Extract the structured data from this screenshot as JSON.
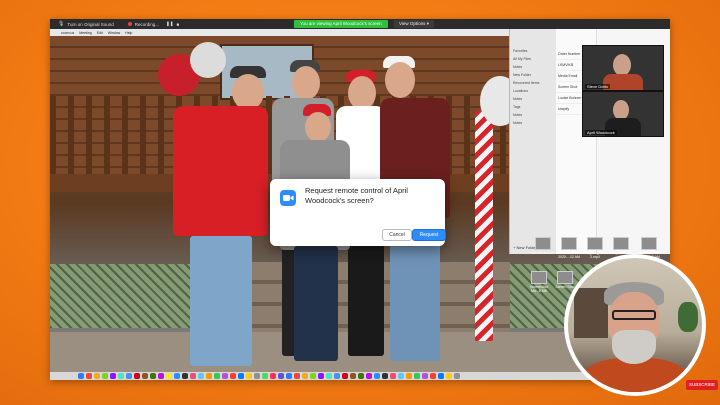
{
  "share_bar": {
    "original_sound": "Turn on Original Sound",
    "recording": "Recording...",
    "viewing_banner": "You are viewing April Woodcock's screen",
    "view_options": "View Options"
  },
  "mac_menu": [
    "zoom.us",
    "Meeting",
    "Edit",
    "Window",
    "Help"
  ],
  "finder": {
    "sidebar": [
      "Favorites",
      "All My Files",
      "Notes",
      "New Folder",
      "Recovered Items",
      "Locations",
      "Notes",
      "Tags",
      "Notes",
      "Notes"
    ],
    "column": [
      "Order Number",
      "LKMVIKB",
      "Media Email",
      "Screen Shot",
      "Louise Bohnen",
      "shopify"
    ],
    "new_folder": "New Folder"
  },
  "video_tiles": [
    {
      "name": "Steve Dotto"
    },
    {
      "name": "April Woodcock"
    }
  ],
  "desktop_icons": [
    {
      "label": "Second Screen"
    },
    {
      "label": "Screen Shot 2020-...12 AM"
    },
    {
      "label": "USA_041_DEL... 2.mp4"
    },
    {
      "label": "IMG_2113_M..."
    },
    {
      "label": "Screen Shot 2020-...12 AM"
    },
    {
      "label": "Screenshot Ma...8 MB"
    },
    {
      "label": "Screen Shot"
    }
  ],
  "dialog": {
    "message": "Request remote control of April Woodcock's screen?",
    "cancel": "Cancel",
    "request": "Request"
  },
  "dock_colors": [
    "#3478f6",
    "#e5483d",
    "#f5a623",
    "#7ed321",
    "#9013fe",
    "#50e3c2",
    "#4a90e2",
    "#d0021b",
    "#8b572a",
    "#417505",
    "#bd10e0",
    "#f8e71c",
    "#2d8cff",
    "#333333",
    "#e94e77",
    "#5ac8fa",
    "#ff9500",
    "#34c759",
    "#af52de",
    "#ff3b30",
    "#007aff",
    "#ffcc00",
    "#8e8e93",
    "#4cd964",
    "#ff2d55",
    "#5856d6",
    "#3478f6",
    "#e5483d",
    "#f5a623",
    "#7ed321",
    "#9013fe",
    "#50e3c2",
    "#4a90e2",
    "#d0021b",
    "#8b572a",
    "#417505",
    "#bd10e0",
    "#2d8cff",
    "#333333",
    "#e94e77",
    "#5ac8fa",
    "#ff9500",
    "#34c759",
    "#af52de",
    "#ff3b30",
    "#007aff",
    "#ffcc00",
    "#8e8e93"
  ],
  "subscribe": "SUBSCRIBE",
  "colors": {
    "background": "#f27a14",
    "zoom_blue": "#2d8cff",
    "share_green": "#2fbf3b"
  }
}
